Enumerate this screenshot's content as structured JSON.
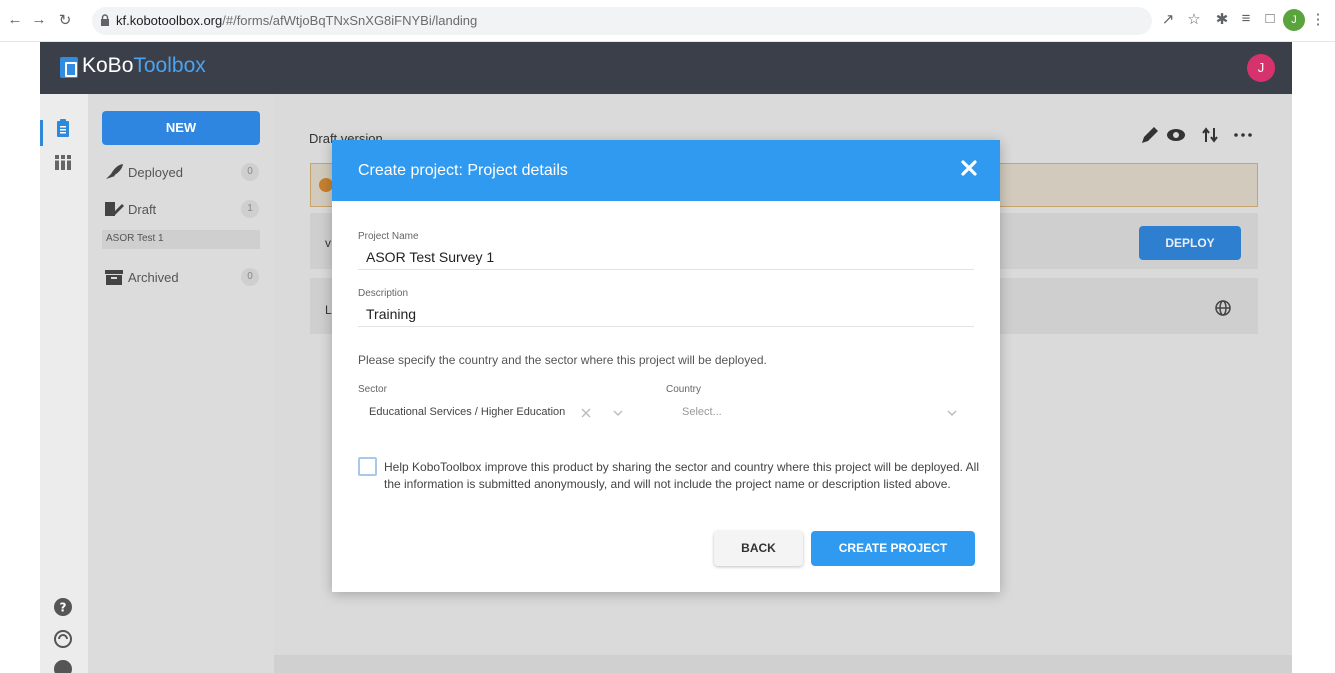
{
  "browser": {
    "url_host": "kf.kobotoolbox.org",
    "url_path": "/#/forms/afWtjoBqTNxSnXG8iFNYBi/landing",
    "profile_initial": "J"
  },
  "app": {
    "logo_part1": "KoBo",
    "logo_part2": "Toolbox",
    "user_initial": "J",
    "accent_color": "#2f9af0",
    "header_color": "#3b3f4a"
  },
  "sidebar": {
    "new_label": "NEW",
    "items": [
      {
        "label": "Deployed",
        "count": "0",
        "icon": "rocket-icon"
      },
      {
        "label": "Draft",
        "count": "1",
        "icon": "draft-pencil-icon"
      },
      {
        "label": "Archived",
        "count": "0",
        "icon": "archive-box-icon"
      }
    ],
    "draft_project": "ASOR Test 1"
  },
  "main": {
    "draft_label": "Draft version",
    "row1_letter": "v",
    "row2_letter": "L",
    "deploy_label": "DEPLOY"
  },
  "modal": {
    "title": "Create project: Project details",
    "project_name_label": "Project Name",
    "project_name_value": "ASOR Test Survey 1",
    "description_label": "Description",
    "description_value": "Training",
    "hint": "Please specify the country and the sector where this project will be deployed.",
    "sector_label": "Sector",
    "sector_value": "Educational Services / Higher Education",
    "country_label": "Country",
    "country_placeholder": "Select...",
    "consent_text": "Help KoboToolbox improve this product by sharing the sector and country where this project will be deployed. All the information is submitted anonymously, and will not include the project name or description listed above.",
    "back_label": "BACK",
    "create_label": "CREATE PROJECT"
  }
}
